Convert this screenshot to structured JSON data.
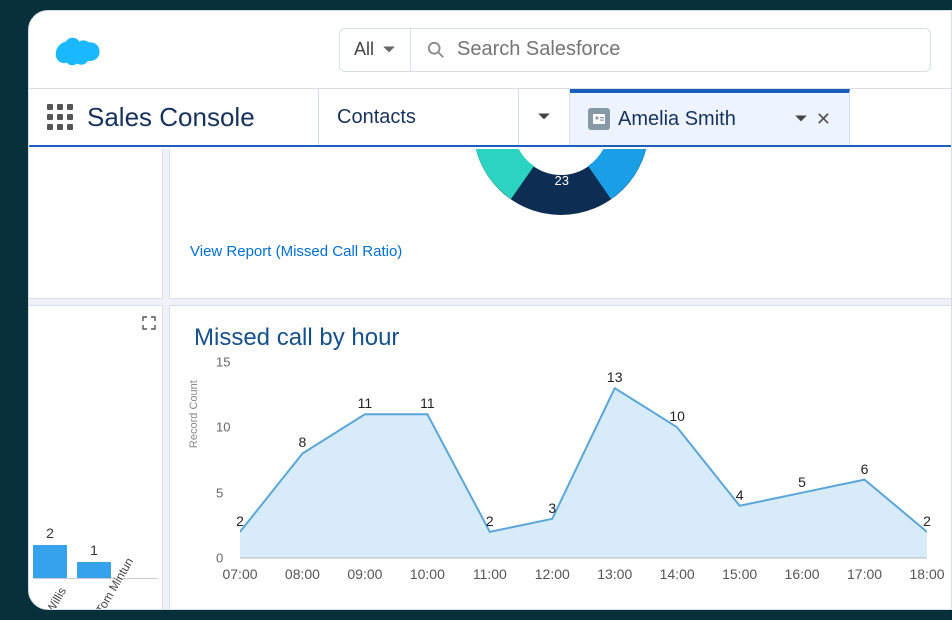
{
  "header": {
    "scope_label": "All",
    "search_placeholder": "Search Salesforce"
  },
  "nav": {
    "app_name": "Sales Console",
    "tabs": [
      {
        "label": "Contacts"
      },
      {
        "label": "Amelia Smith",
        "active": true
      }
    ]
  },
  "top_right": {
    "link_text": "View Report (Missed Call Ratio)",
    "donut_center_label": "23"
  },
  "bottom_left": {
    "bar1_value": "2",
    "bar2_value": "1",
    "bar1_label": "Willis",
    "bar2_label": "Tom Mintun"
  },
  "bottom_right": {
    "title": "Missed call by hour",
    "ylabel": "Record Count"
  },
  "chart_data": [
    {
      "type": "donut",
      "note": "partial view only",
      "center_label": 23,
      "segments_visible": [
        "teal",
        "navy",
        "blue"
      ]
    },
    {
      "type": "bar",
      "note": "partial view truncated on left",
      "categories": [
        "Willis",
        "Tom Mintun"
      ],
      "values": [
        2,
        1
      ]
    },
    {
      "type": "area",
      "title": "Missed call by hour",
      "ylabel": "Record Count",
      "ylim": [
        0,
        15
      ],
      "yticks": [
        0,
        5,
        10,
        15
      ],
      "x": [
        "07:00",
        "08:00",
        "09:00",
        "10:00",
        "11:00",
        "12:00",
        "13:00",
        "14:00",
        "15:00",
        "16:00",
        "17:00",
        "18:00"
      ],
      "values": [
        2,
        8,
        11,
        11,
        2,
        3,
        13,
        10,
        4,
        5,
        6,
        2
      ]
    }
  ]
}
